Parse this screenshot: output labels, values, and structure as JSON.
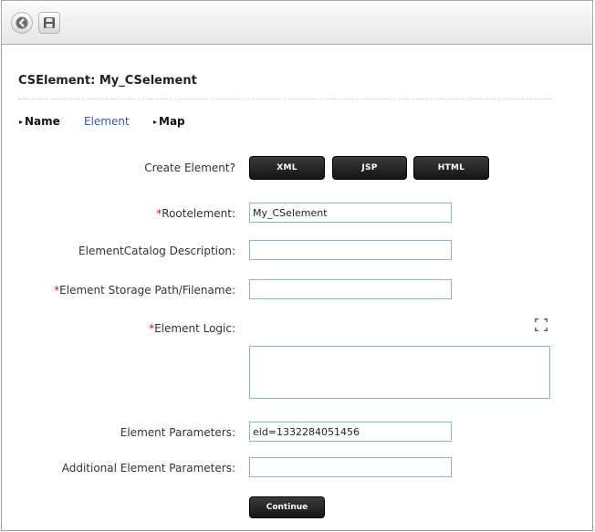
{
  "toolbar": {
    "back_icon": "back-arrow-icon",
    "save_icon": "save-disk-icon"
  },
  "page": {
    "title": "CSElement: My_CSelement"
  },
  "tabs": [
    {
      "label": "Name",
      "marker": "▸"
    },
    {
      "label": "Element"
    },
    {
      "label": "Map",
      "marker": "▸"
    }
  ],
  "form": {
    "create_element": {
      "label": "Create Element?",
      "buttons": [
        "XML",
        "JSP",
        "HTML"
      ]
    },
    "required_marker": "*",
    "rootelement": {
      "label": "Rootelement:",
      "value": "My_CSelement",
      "required": true
    },
    "catalog_description": {
      "label": "ElementCatalog Description:",
      "value": ""
    },
    "storage_path": {
      "label": "Element Storage Path/Filename:",
      "value": "",
      "required": true
    },
    "element_logic": {
      "label": "Element Logic:",
      "value": "",
      "required": true
    },
    "element_parameters": {
      "label": "Element Parameters:",
      "value": "eid=1332284051456"
    },
    "additional_parameters": {
      "label": "Additional Element Parameters:",
      "value": ""
    },
    "continue_label": "Continue"
  },
  "colors": {
    "required": "#cc1111",
    "active_tab": "#2f5ab5",
    "button_bg": "#1c1c1c",
    "input_border": "#8fb3cf"
  }
}
